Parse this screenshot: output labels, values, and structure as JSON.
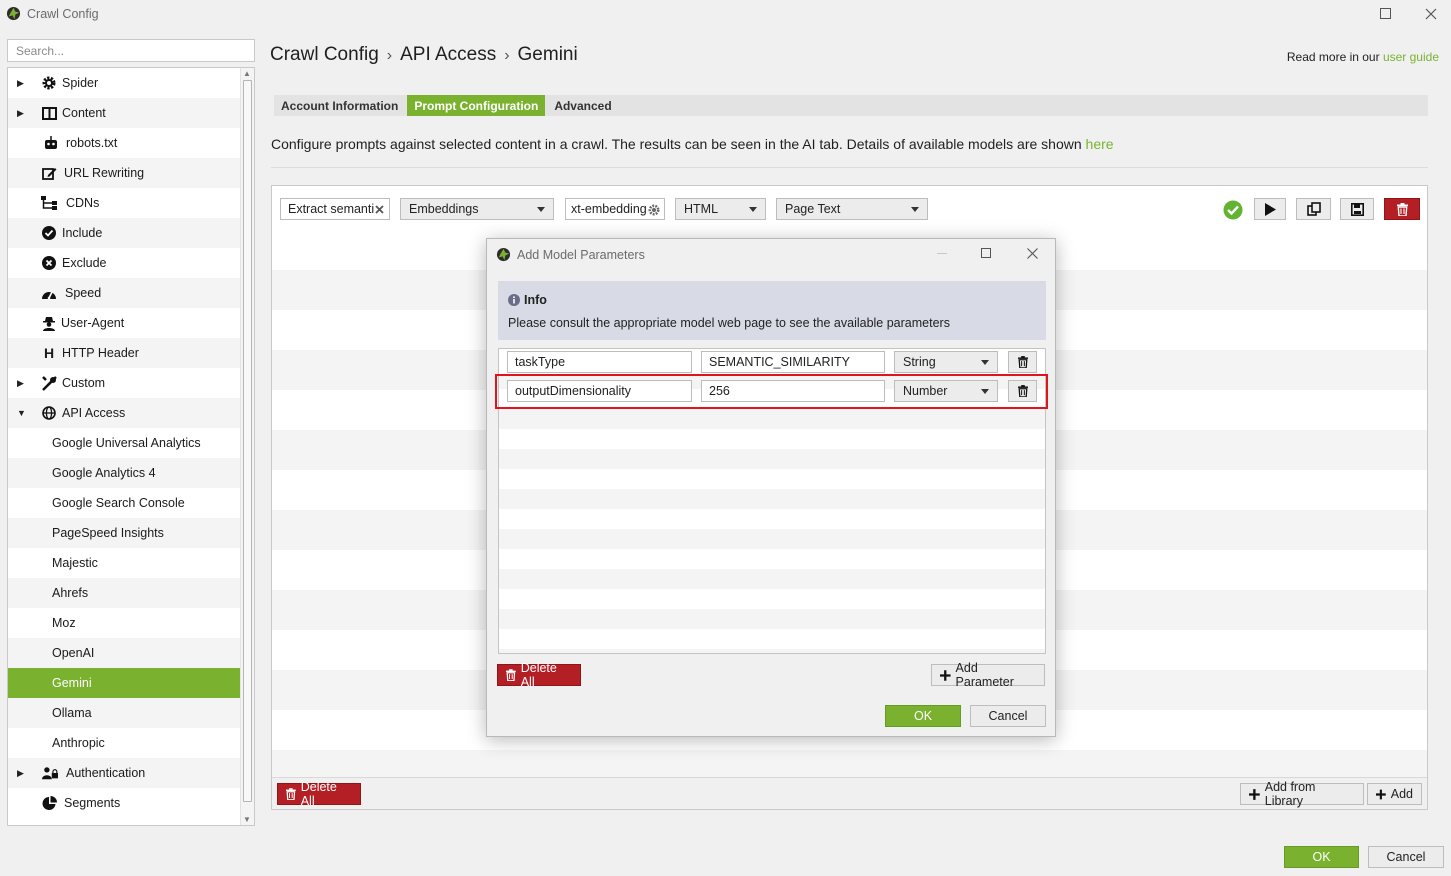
{
  "window": {
    "title": "Crawl Config"
  },
  "search": {
    "placeholder": "Search..."
  },
  "sidebar": {
    "items": [
      {
        "label": "Spider",
        "icon": "gear-icon",
        "expandable": true
      },
      {
        "label": "Content",
        "icon": "columns-icon",
        "expandable": true
      },
      {
        "label": "robots.txt",
        "icon": "robot-icon"
      },
      {
        "label": "URL Rewriting",
        "icon": "edit-icon"
      },
      {
        "label": "CDNs",
        "icon": "sitemap-icon"
      },
      {
        "label": "Include",
        "icon": "check-circle-icon"
      },
      {
        "label": "Exclude",
        "icon": "x-circle-icon"
      },
      {
        "label": "Speed",
        "icon": "speedometer-icon"
      },
      {
        "label": "User-Agent",
        "icon": "user-secret-icon"
      },
      {
        "label": "HTTP Header",
        "icon": "header-icon"
      },
      {
        "label": "Custom",
        "icon": "tools-icon",
        "expandable": true
      },
      {
        "label": "API Access",
        "icon": "globe-icon",
        "expanded": true
      },
      {
        "label": "Google Universal Analytics"
      },
      {
        "label": "Google Analytics 4"
      },
      {
        "label": "Google Search Console"
      },
      {
        "label": "PageSpeed Insights"
      },
      {
        "label": "Majestic"
      },
      {
        "label": "Ahrefs"
      },
      {
        "label": "Moz"
      },
      {
        "label": "OpenAI"
      },
      {
        "label": "Gemini",
        "selected": true
      },
      {
        "label": "Ollama"
      },
      {
        "label": "Anthropic"
      },
      {
        "label": "Authentication",
        "icon": "user-lock-icon",
        "expandable": true
      },
      {
        "label": "Segments",
        "icon": "pie-chart-icon"
      }
    ]
  },
  "breadcrumb": [
    "Crawl Config",
    "API Access",
    "Gemini"
  ],
  "guide": {
    "prefix": "Read more in our",
    "link": "user guide"
  },
  "tabs": [
    "Account Information",
    "Prompt Configuration",
    "Advanced"
  ],
  "description": {
    "text": "Configure prompts against selected content in a crawl. The results can be seen in the AI tab. Details of available models are shown",
    "link": "here"
  },
  "prompt_row": {
    "name": "Extract semanti",
    "type": "Embeddings",
    "model": "xt-embedding",
    "content": "HTML",
    "element": "Page Text"
  },
  "panel_footer": {
    "delete_all": "Delete All",
    "add_from_library": "Add from Library",
    "add": "Add"
  },
  "dialog": {
    "title": "Add Model Parameters",
    "info_title": "Info",
    "info_text": "Please consult the appropriate model web page to see the available parameters",
    "params": [
      {
        "name": "taskType",
        "value": "SEMANTIC_SIMILARITY",
        "type": "String"
      },
      {
        "name": "outputDimensionality",
        "value": "256",
        "type": "Number"
      }
    ],
    "delete_all": "Delete All",
    "add_parameter": "Add Parameter",
    "ok": "OK",
    "cancel": "Cancel"
  },
  "footer": {
    "ok": "OK",
    "cancel": "Cancel"
  },
  "colors": {
    "accent": "#7ab230",
    "danger": "#b31f24",
    "highlight": "#e0141c",
    "info_bg": "#d8dbe6"
  }
}
